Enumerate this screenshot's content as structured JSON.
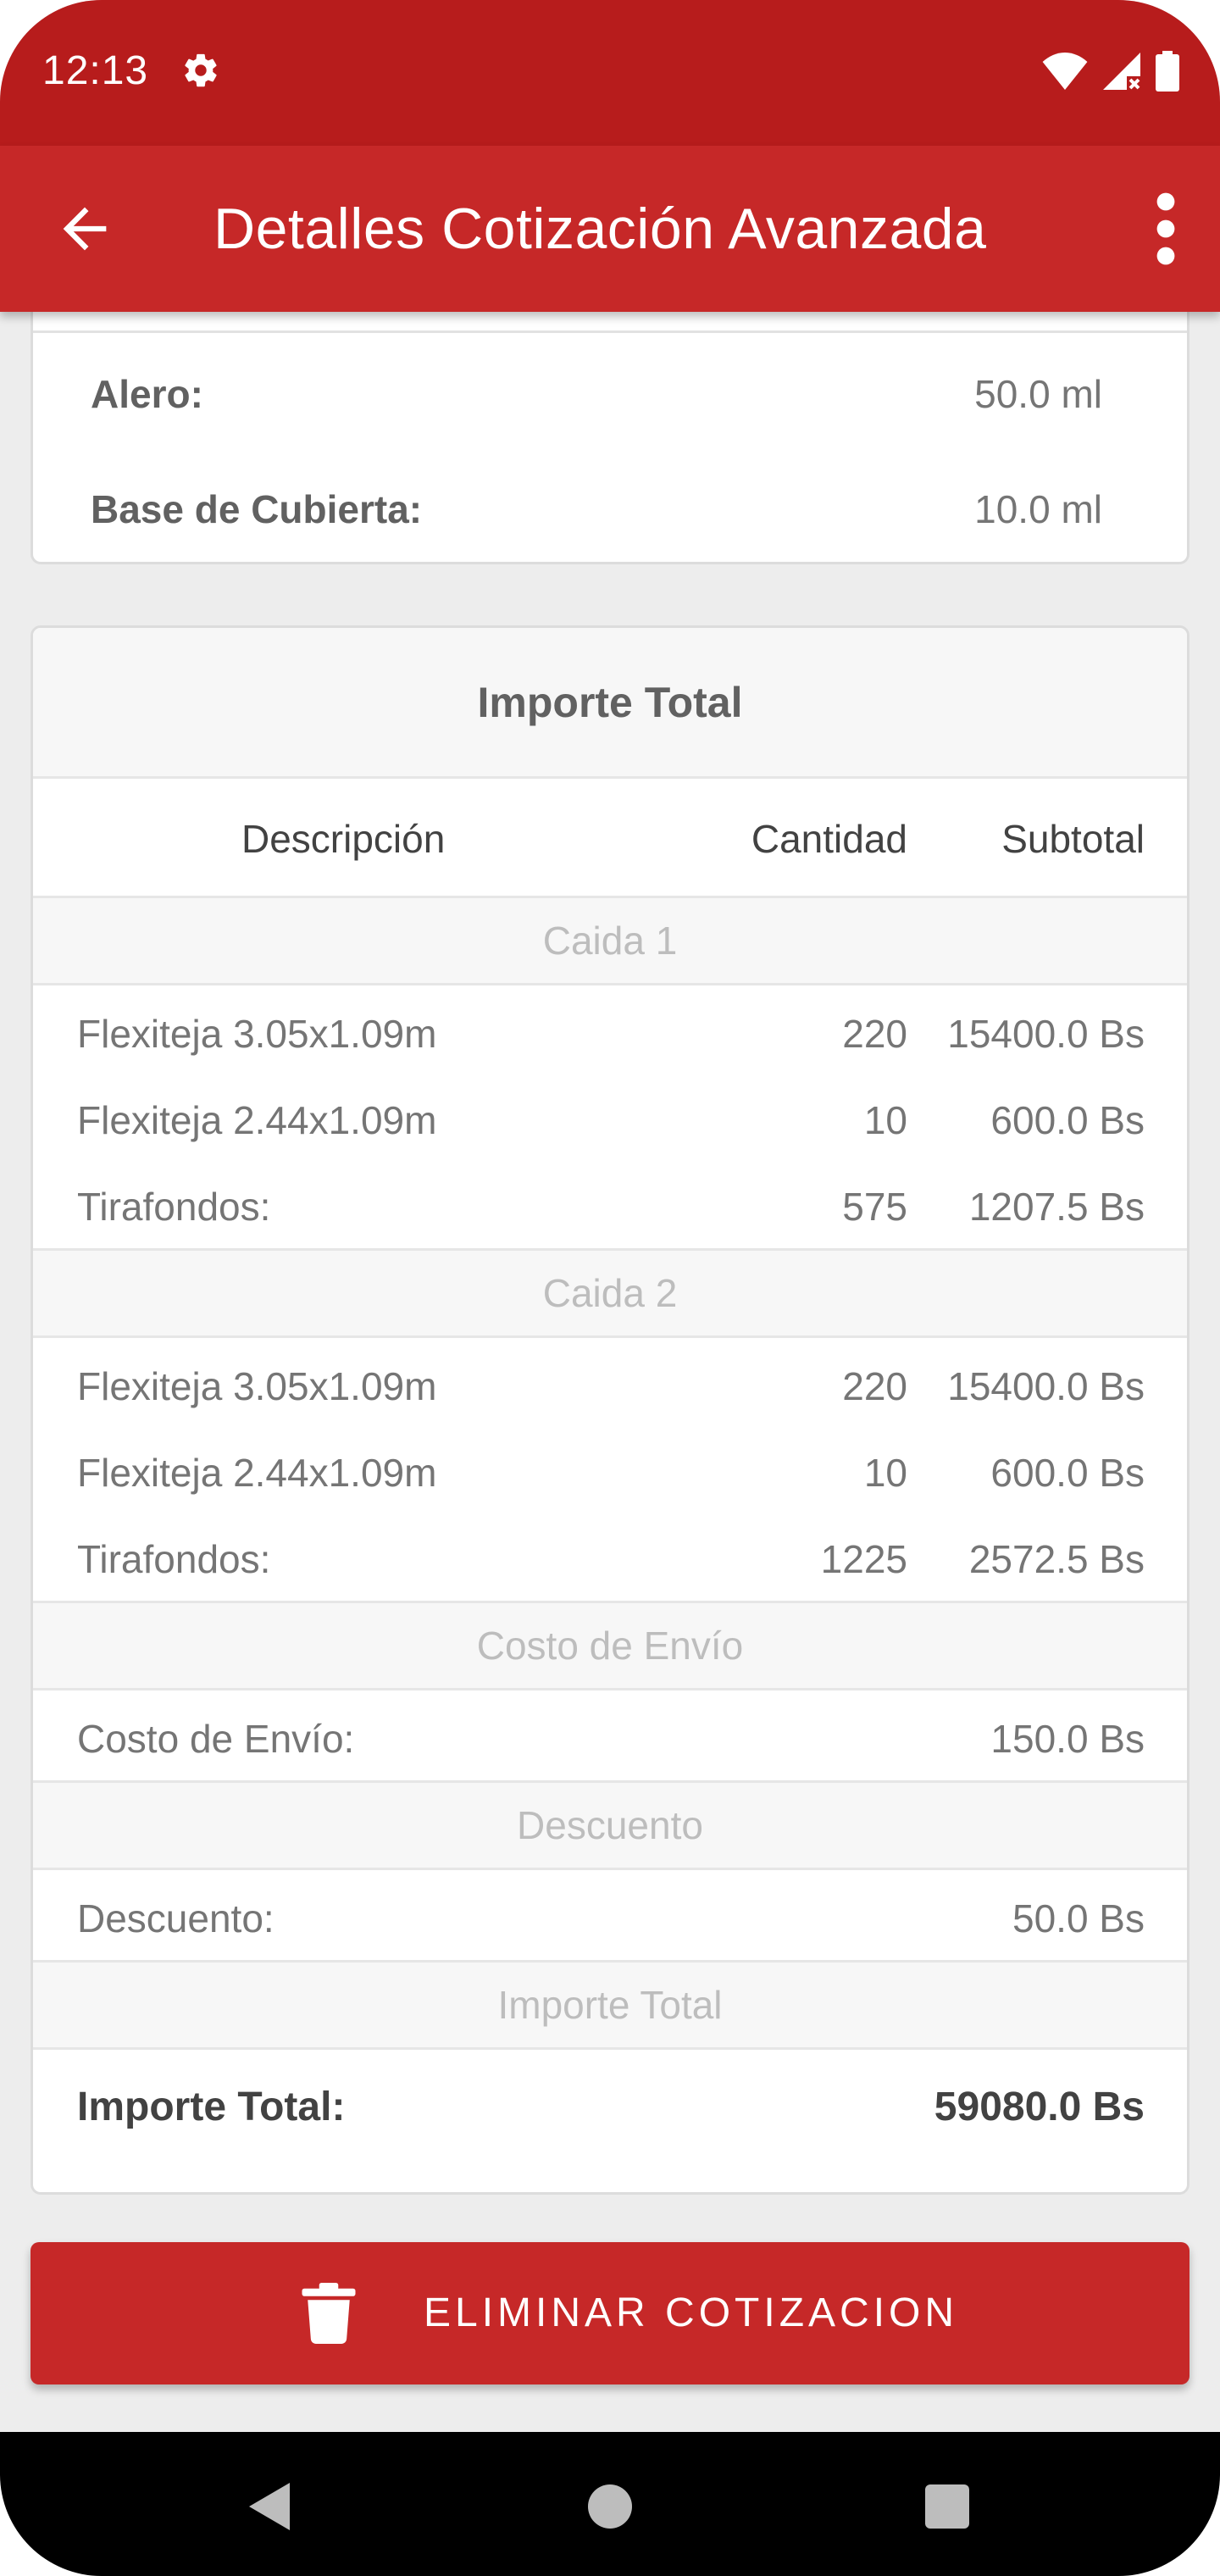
{
  "status_bar": {
    "time": "12:13"
  },
  "app_bar": {
    "title": "Detalles Cotización Avanzada"
  },
  "summary_card": {
    "rows": [
      {
        "label": "Alero:",
        "value": "50.0 ml"
      },
      {
        "label": "Base de Cubierta:",
        "value": "10.0 ml"
      }
    ]
  },
  "total_card": {
    "title": "Importe Total",
    "columns": {
      "description": "Descripción",
      "quantity": "Cantidad",
      "subtotal": "Subtotal"
    },
    "sections": [
      {
        "title": "Caida 1",
        "rows": [
          {
            "description": "Flexiteja 3.05x1.09m",
            "quantity": "220",
            "subtotal": "15400.0 Bs"
          },
          {
            "description": "Flexiteja 2.44x1.09m",
            "quantity": "10",
            "subtotal": "600.0 Bs"
          },
          {
            "description": "Tirafondos:",
            "quantity": "575",
            "subtotal": "1207.5 Bs"
          }
        ]
      },
      {
        "title": "Caida 2",
        "rows": [
          {
            "description": "Flexiteja 3.05x1.09m",
            "quantity": "220",
            "subtotal": "15400.0 Bs"
          },
          {
            "description": "Flexiteja 2.44x1.09m",
            "quantity": "10",
            "subtotal": "600.0 Bs"
          },
          {
            "description": "Tirafondos:",
            "quantity": "1225",
            "subtotal": "2572.5 Bs"
          }
        ]
      },
      {
        "title": "Costo de Envío",
        "rows": [
          {
            "description": "Costo de Envío:",
            "subtotal": "150.0 Bs"
          }
        ]
      },
      {
        "title": "Descuento",
        "rows": [
          {
            "description": "Descuento:",
            "subtotal": "50.0 Bs"
          }
        ]
      },
      {
        "title": "Importe Total"
      }
    ],
    "total": {
      "label": "Importe Total:",
      "value": "59080.0 Bs"
    }
  },
  "delete_button": {
    "label": "ELIMINAR COTIZACION"
  },
  "colors": {
    "status_bar": "#b71c1c",
    "app_bar": "#c62828",
    "button": "#c62828"
  },
  "icons": [
    "gear-icon",
    "wifi-icon",
    "signal-icon",
    "battery-icon",
    "back-arrow-icon",
    "more-vert-icon",
    "trash-icon",
    "nav-back-icon",
    "nav-home-icon",
    "nav-recents-icon"
  ]
}
